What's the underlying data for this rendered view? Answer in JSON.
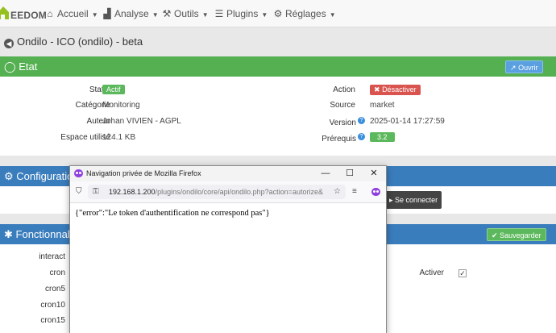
{
  "navbar": {
    "logo_text": "EEDOM",
    "items": [
      {
        "label": "Accueil",
        "icon": "home-icon"
      },
      {
        "label": "Analyse",
        "icon": "chart-icon"
      },
      {
        "label": "Outils",
        "icon": "wrench-icon"
      },
      {
        "label": "Plugins",
        "icon": "list-icon"
      },
      {
        "label": "Réglages",
        "icon": "gear-icon"
      }
    ]
  },
  "page": {
    "title": "Ondilo - ICO (ondilo) - beta"
  },
  "etat": {
    "title": "Etat",
    "open_button": "Ouvrir",
    "rows_left": [
      {
        "label": "Statut",
        "value": "Actif"
      },
      {
        "label": "Catégorie",
        "value": "Monitoring"
      },
      {
        "label": "Auteur",
        "value": "Johan VIVIEN - AGPL"
      },
      {
        "label": "Espace utilisé",
        "value": "124.1 KB"
      }
    ],
    "rows_right": [
      {
        "label": "Action",
        "value": "Désactiver"
      },
      {
        "label": "Source",
        "value": "market"
      },
      {
        "label": "Version",
        "value": "2025-01-14 17:27:59"
      },
      {
        "label": "Prérequis",
        "value": "3.2"
      }
    ]
  },
  "configuration": {
    "title": "Configuration",
    "connect_button": "Se connecter"
  },
  "fonctionnalites": {
    "title": "Fonctionnalités",
    "save_button": "Sauvegarder",
    "rows": [
      "interact",
      "cron",
      "cron5",
      "cron10",
      "cron15"
    ],
    "activate_label": "Activer",
    "activate_checked": true
  },
  "browser": {
    "title": "Navigation privée de Mozilla Firefox",
    "url_host": "192.168.1.200",
    "url_path": "/plugins/ondilo/core/api/ondilo.php?action=autorize&",
    "content": "{\"error\":\"Le token d'authentification ne correspond pas\"}"
  },
  "colors": {
    "green_header": "#55b052",
    "blue_header": "#3a7dbd",
    "badge_green": "#5cb85c",
    "badge_red": "#d9534f"
  }
}
